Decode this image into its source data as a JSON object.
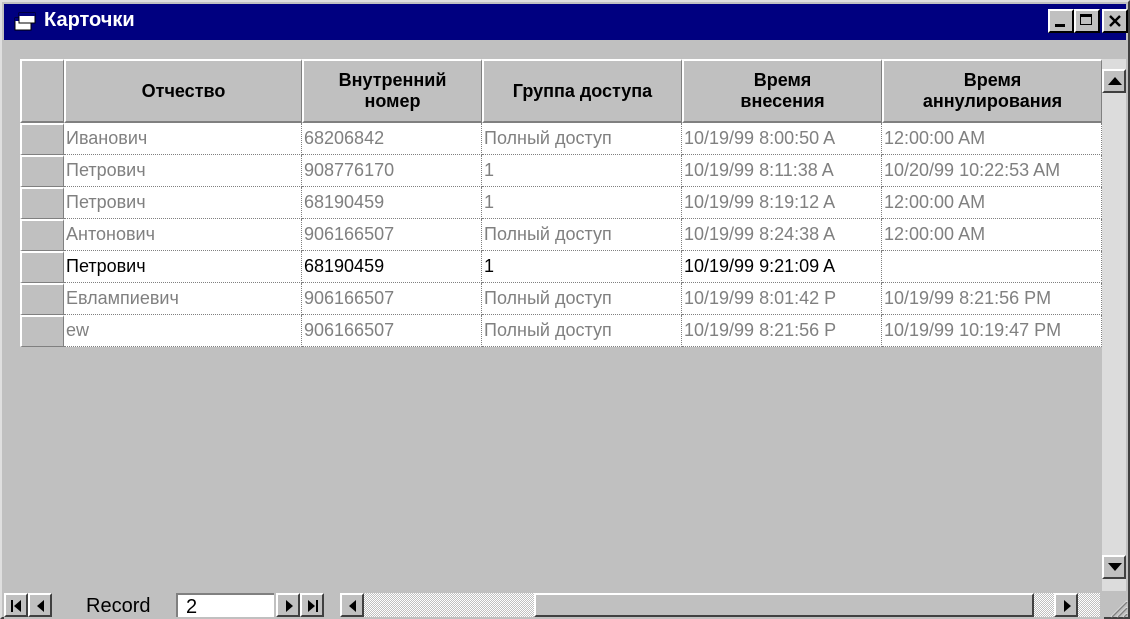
{
  "window": {
    "title": "Карточки"
  },
  "titlebar_buttons": [
    "minimize-icon",
    "maximize-icon",
    "close-icon"
  ],
  "columns": [
    {
      "label": "Отчество"
    },
    {
      "label": "Внутренний\nномер"
    },
    {
      "label": "Группа доступа"
    },
    {
      "label": "Время\nвнесения"
    },
    {
      "label": "Время\nаннулирования"
    }
  ],
  "rows": [
    {
      "patronymic": "Иванович",
      "internal_number": "68206842",
      "access_group": "Полный доступ",
      "entry_time": "10/19/99 8:00:50 A",
      "cancel_time": "12:00:00 AM"
    },
    {
      "patronymic": "Петрович",
      "internal_number": "908776170",
      "access_group": "1",
      "entry_time": "10/19/99 8:11:38 A",
      "cancel_time": "10/20/99 10:22:53 AM"
    },
    {
      "patronymic": "Петрович",
      "internal_number": "68190459",
      "access_group": "1",
      "entry_time": "10/19/99 8:19:12 A",
      "cancel_time": "12:00:00 AM"
    },
    {
      "patronymic": "Антонович",
      "internal_number": "906166507",
      "access_group": "Полный доступ",
      "entry_time": "10/19/99 8:24:38 A",
      "cancel_time": "12:00:00 AM"
    },
    {
      "patronymic": "Петрович",
      "internal_number": "68190459",
      "access_group": "1",
      "entry_time": "10/19/99 9:21:09 A",
      "cancel_time": ""
    },
    {
      "patronymic": "Евлампиевич",
      "internal_number": "906166507",
      "access_group": "Полный доступ",
      "entry_time": "10/19/99 8:01:42 P",
      "cancel_time": "10/19/99 8:21:56 PM"
    },
    {
      "patronymic": "ew",
      "internal_number": "906166507",
      "access_group": "Полный доступ",
      "entry_time": "10/19/99 8:21:56 P",
      "cancel_time": "10/19/99 10:19:47 PM"
    }
  ],
  "current_row_index": 4,
  "navigation": {
    "record_label": "Record",
    "record_number": "2"
  },
  "colors": {
    "titlebar": "#000080",
    "face": "#c0c0c0",
    "inactive_text": "#808080",
    "active_text": "#000000"
  }
}
